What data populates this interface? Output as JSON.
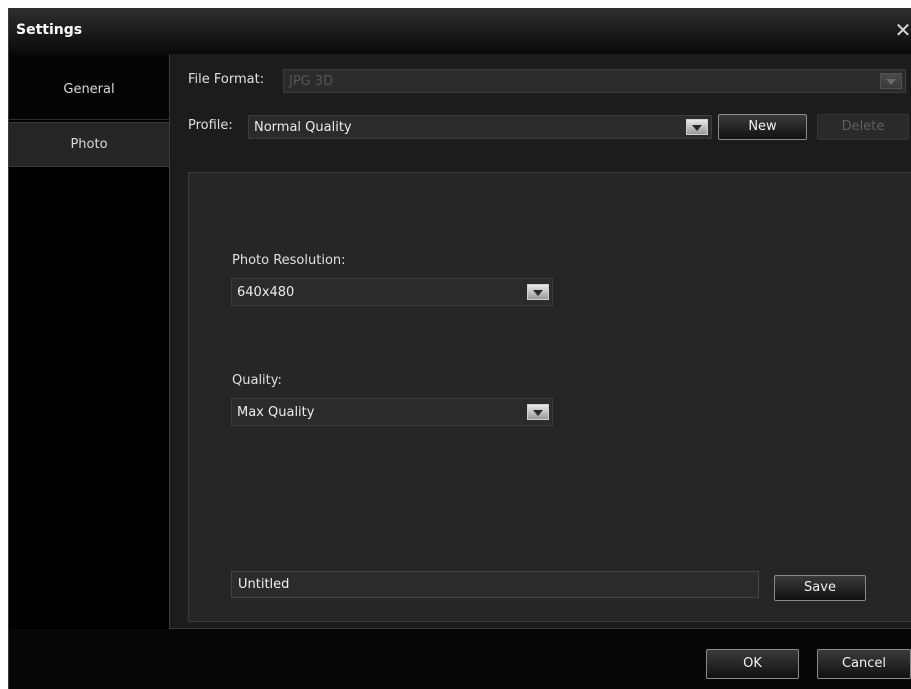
{
  "window": {
    "title": "Settings",
    "close_glyph": "✕"
  },
  "sidebar": {
    "tabs": [
      {
        "label": "General",
        "selected": false
      },
      {
        "label": "Photo",
        "selected": true
      }
    ]
  },
  "file_format": {
    "label": "File Format:",
    "value": "JPG 3D",
    "disabled": true
  },
  "profile": {
    "label": "Profile:",
    "value": "Normal Quality",
    "new_label": "New",
    "delete_label": "Delete",
    "delete_disabled": true
  },
  "photo_resolution": {
    "label": "Photo Resolution:",
    "value": "640x480"
  },
  "quality": {
    "label": "Quality:",
    "value": "Max Quality"
  },
  "profile_name": {
    "value": "Untitled",
    "save_label": "Save"
  },
  "footer": {
    "ok_label": "OK",
    "cancel_label": "Cancel"
  },
  "icons": {
    "close": "close-icon",
    "dropdown": "chevron-down-icon"
  },
  "colors": {
    "window_bg": "#070707",
    "panel_bg": "#262626",
    "text": "#e6e6e6",
    "disabled_text": "#5e5e5e"
  }
}
